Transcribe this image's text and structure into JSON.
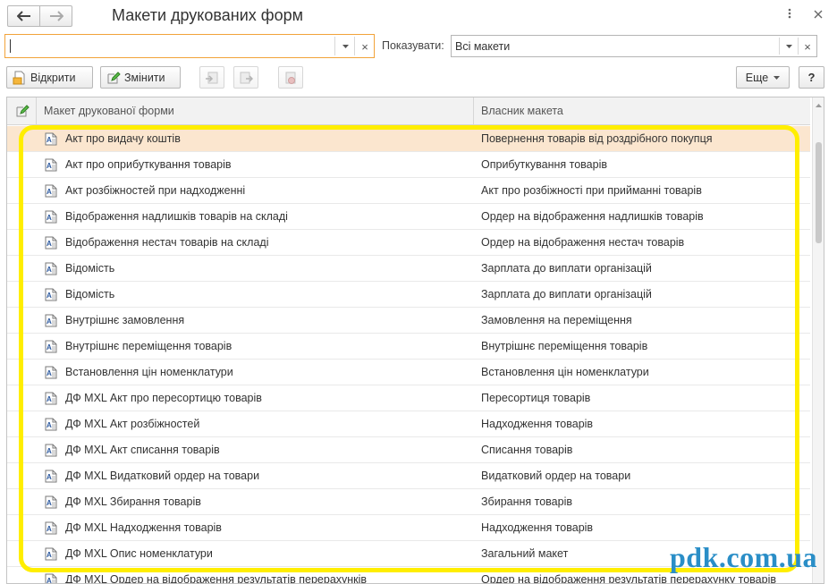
{
  "window": {
    "title": "Макети друкованих форм",
    "menu_icon": "more-vertical-icon",
    "close_icon": "close-icon"
  },
  "nav": {
    "back_icon": "arrow-left-icon",
    "forward_icon": "arrow-right-icon"
  },
  "search": {
    "value": "",
    "dropdown_icon": "chevron-down-icon",
    "clear_label": "×"
  },
  "filter": {
    "label": "Показувати:",
    "value": "Всі макети",
    "clear_label": "×"
  },
  "toolbar": {
    "open_label": "Відкрити",
    "edit_label": "Змінити",
    "more_label": "Еще",
    "help_label": "?"
  },
  "table": {
    "columns": [
      "Макет друкованої форми",
      "Власник макета"
    ],
    "rows": [
      {
        "name": "Акт про видачу коштів",
        "owner": "Повернення товарів від роздрібного покупця",
        "selected": true
      },
      {
        "name": "Акт про оприбуткування товарів",
        "owner": "Оприбуткування товарів"
      },
      {
        "name": "Акт розбіжностей при надходженні",
        "owner": "Акт про розбіжності при прийманні товарів"
      },
      {
        "name": "Відображення надлишків товарів на складі",
        "owner": "Ордер на відображення надлишків товарів"
      },
      {
        "name": "Відображення нестач товарів на складі",
        "owner": "Ордер на відображення нестач товарів"
      },
      {
        "name": "Відомість",
        "owner": "Зарплата до виплати організацій"
      },
      {
        "name": "Відомість",
        "owner": "Зарплата до виплати організацій"
      },
      {
        "name": "Внутрішнє замовлення",
        "owner": "Замовлення на переміщення"
      },
      {
        "name": "Внутрішнє переміщення товарів",
        "owner": "Внутрішнє переміщення товарів"
      },
      {
        "name": "Встановлення цін номенклатури",
        "owner": "Встановлення цін номенклатури"
      },
      {
        "name": "ДФ MXL Акт про пересортицю товарів",
        "owner": "Пересортиця товарів"
      },
      {
        "name": "ДФ MXL Акт розбіжностей",
        "owner": "Надходження товарів"
      },
      {
        "name": "ДФ MXL Акт списання товарів",
        "owner": "Списання товарів"
      },
      {
        "name": "ДФ MXL Видатковий ордер на товари",
        "owner": "Видатковий ордер на товари"
      },
      {
        "name": "ДФ MXL Збирання товарів",
        "owner": "Збирання товарів"
      },
      {
        "name": "ДФ MXL Надходження товарів",
        "owner": "Надходження товарів"
      },
      {
        "name": "ДФ MXL Опис номенклатури",
        "owner": "Загальний макет"
      },
      {
        "name": "ДФ MXL Ордер на відображення результатів перерахунків",
        "owner": "Ордер на відображення результатів перерахунку товарів"
      }
    ]
  },
  "watermark": "pdk.com.ua",
  "colors": {
    "selected_row": "#fbe6cf",
    "highlight": "#ffee00",
    "watermark": "#2a8ec7",
    "focus_border": "#f2a33a"
  }
}
